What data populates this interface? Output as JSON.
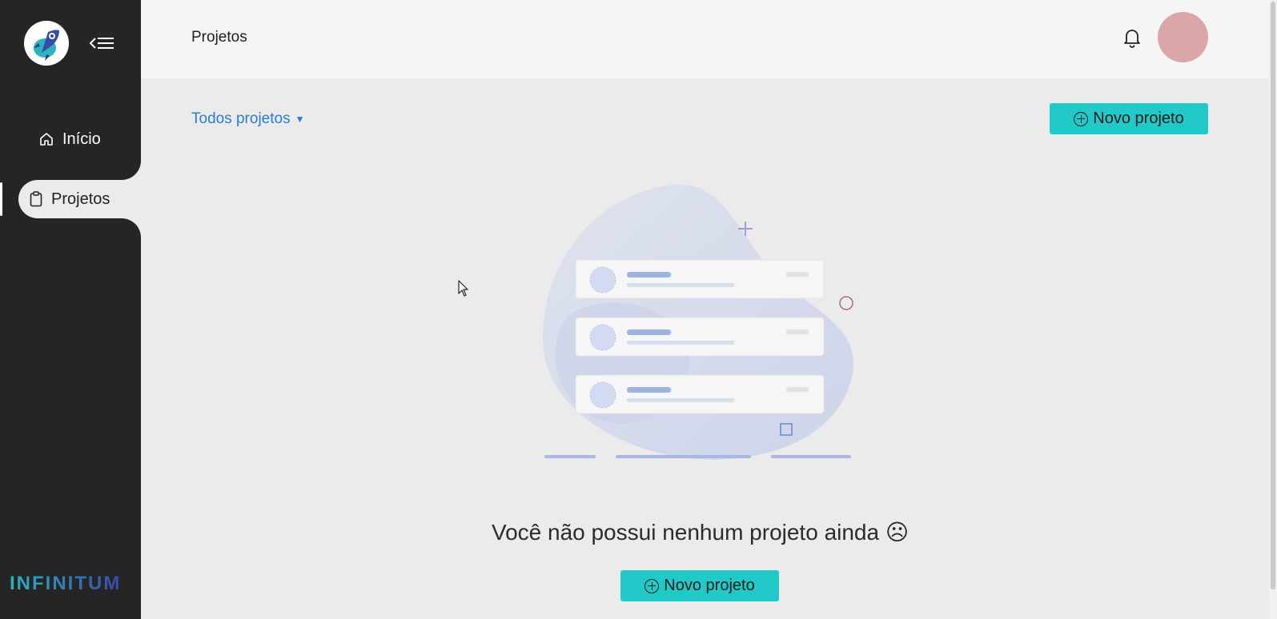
{
  "sidebar": {
    "logo_icon": "rocket-logo-icon",
    "collapse_icon": "collapse-menu-icon",
    "items": [
      {
        "label": "Início",
        "icon": "home-icon",
        "active": false
      },
      {
        "label": "Projetos",
        "icon": "clipboard-icon",
        "active": true
      }
    ],
    "brand": "INFINITUM"
  },
  "header": {
    "title": "Projetos",
    "bell_icon": "bell-icon",
    "avatar_color": "#dba6a8"
  },
  "main": {
    "filter_label": "Todos projetos",
    "new_project_label": "Novo projeto",
    "empty_message": "Você não possui nenhum projeto ainda ☹",
    "empty_button_label": "Novo projeto"
  },
  "colors": {
    "sidebar_bg": "#252525",
    "accent": "#22c9c9",
    "link": "#2a7ad6",
    "page_bg": "#ebebeb",
    "header_bg": "#f5f5f5"
  }
}
